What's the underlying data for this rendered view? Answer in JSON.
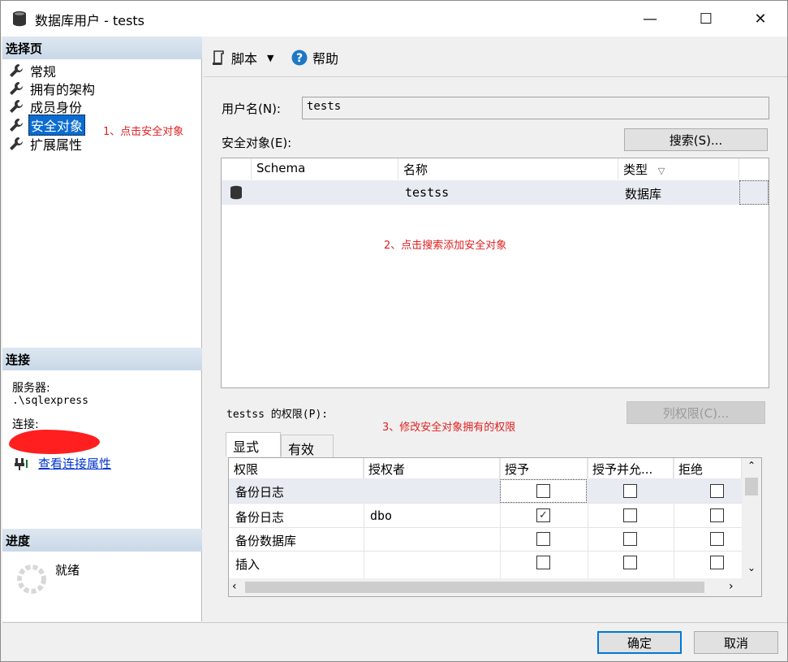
{
  "window": {
    "title": "数据库用户 - tests",
    "controls": {
      "minimize": "—",
      "maximize": "☐",
      "close": "✕"
    }
  },
  "left": {
    "select_page_header": "选择页",
    "nav": [
      {
        "label": "常规",
        "selected": false
      },
      {
        "label": "拥有的架构",
        "selected": false
      },
      {
        "label": "成员身份",
        "selected": false
      },
      {
        "label": "安全对象",
        "selected": true
      },
      {
        "label": "扩展属性",
        "selected": false
      }
    ],
    "annotation_1": "1、点击安全对象",
    "connection_header": "连接",
    "server_label": "服务器:",
    "server_value": ".\\sqlexpress",
    "connection_label": "连接:",
    "view_connection_props": "查看连接属性",
    "progress_header": "进度",
    "progress_status": "就绪"
  },
  "toolbar": {
    "script_label": "脚本",
    "help_label": "帮助"
  },
  "form": {
    "username_label": "用户名(N):",
    "username_value": "tests",
    "securables_label": "安全对象(E):",
    "search_button": "搜索(S)...",
    "annotation_2": "2、点击搜索添加安全对象",
    "securables_columns": [
      "Schema",
      "名称",
      "类型"
    ],
    "securables_rows": [
      {
        "schema": "",
        "name": "testss",
        "type": "数据库"
      }
    ],
    "permissions_label": "testss 的权限(P):",
    "annotation_3": "3、修改安全对象拥有的权限",
    "column_permissions_button": "列权限(C)...",
    "tabs": [
      "显式",
      "有效"
    ],
    "perm_columns": [
      "权限",
      "授权者",
      "授予",
      "授予并允...",
      "拒绝"
    ],
    "perm_rows": [
      {
        "permission": "备份日志",
        "grantor": "",
        "grant": false,
        "with_grant": false,
        "deny": false
      },
      {
        "permission": "备份日志",
        "grantor": "dbo",
        "grant": true,
        "with_grant": false,
        "deny": false
      },
      {
        "permission": "备份数据库",
        "grantor": "",
        "grant": false,
        "with_grant": false,
        "deny": false
      },
      {
        "permission": "插入",
        "grantor": "",
        "grant": false,
        "with_grant": false,
        "deny": false
      }
    ]
  },
  "footer": {
    "ok_button": "确定",
    "cancel_button": "取消"
  }
}
